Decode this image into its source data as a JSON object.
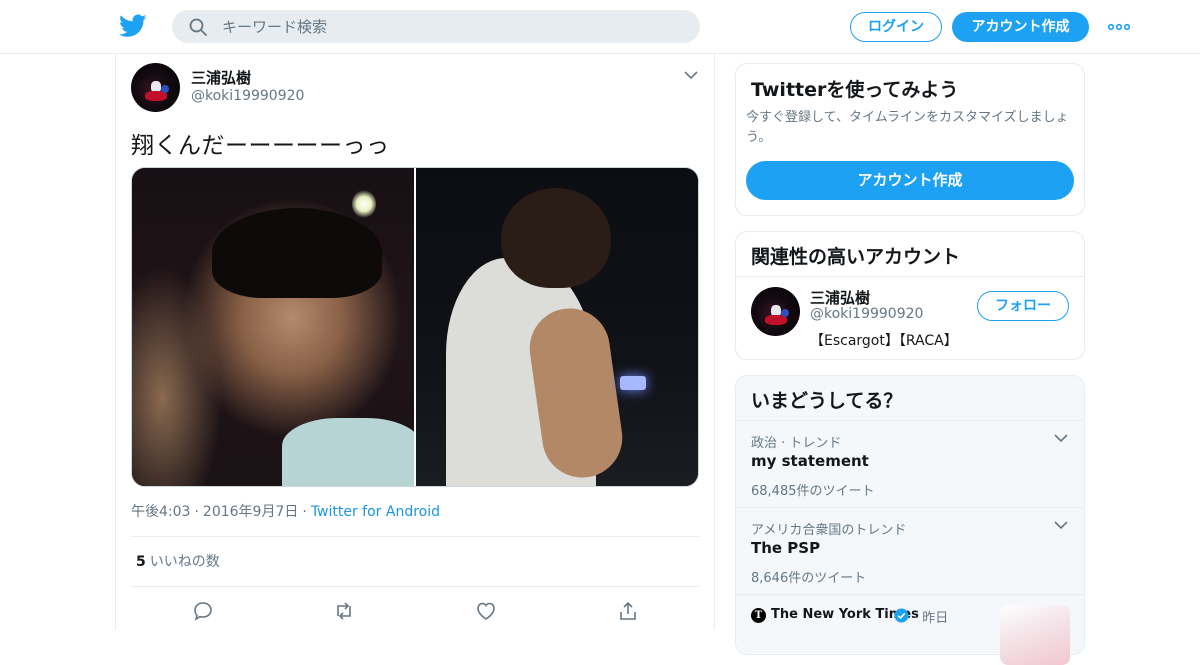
{
  "header": {
    "search_placeholder": "キーワード検索",
    "login_label": "ログイン",
    "signup_label": "アカウント作成"
  },
  "tweet": {
    "author_name": "三浦弘樹",
    "author_handle": "@koki19990920",
    "text": "翔くんだーーーーーっっ",
    "time": "午後4:03",
    "date": "2016年9月7日",
    "source": "Twitter for Android",
    "likes_count": "5",
    "likes_label": "いいねの数"
  },
  "sidebar": {
    "signup_card": {
      "title": "Twitterを使ってみよう",
      "description": "今すぐ登録して、タイムラインをカスタマイズしましょう。",
      "button_label": "アカウント作成"
    },
    "related": {
      "title": "関連性の高いアカウント",
      "account": {
        "name": "三浦弘樹",
        "handle": "@koki19990920",
        "bio": "【Escargot】【RACA】",
        "follow_label": "フォロー"
      }
    },
    "trends": {
      "title": "いまどうしてる？",
      "items": [
        {
          "context": "政治 · トレンド",
          "name": "my statement",
          "count": "68,485件のツイート"
        },
        {
          "context": "アメリカ合衆国のトレンド",
          "name": "The PSP",
          "count": "8,646件のツイート"
        }
      ],
      "news": {
        "source": "The New York Times",
        "time": "昨日"
      }
    }
  },
  "colors": {
    "accent": "#1da1f2",
    "link": "#1b95e0",
    "secondary_text": "#657786",
    "border": "#e6ecf0"
  },
  "icons": [
    "twitter-bird-icon",
    "search-icon",
    "more-icon",
    "chevron-down-icon",
    "reply-icon",
    "retweet-icon",
    "like-icon",
    "share-icon",
    "verified-icon"
  ]
}
